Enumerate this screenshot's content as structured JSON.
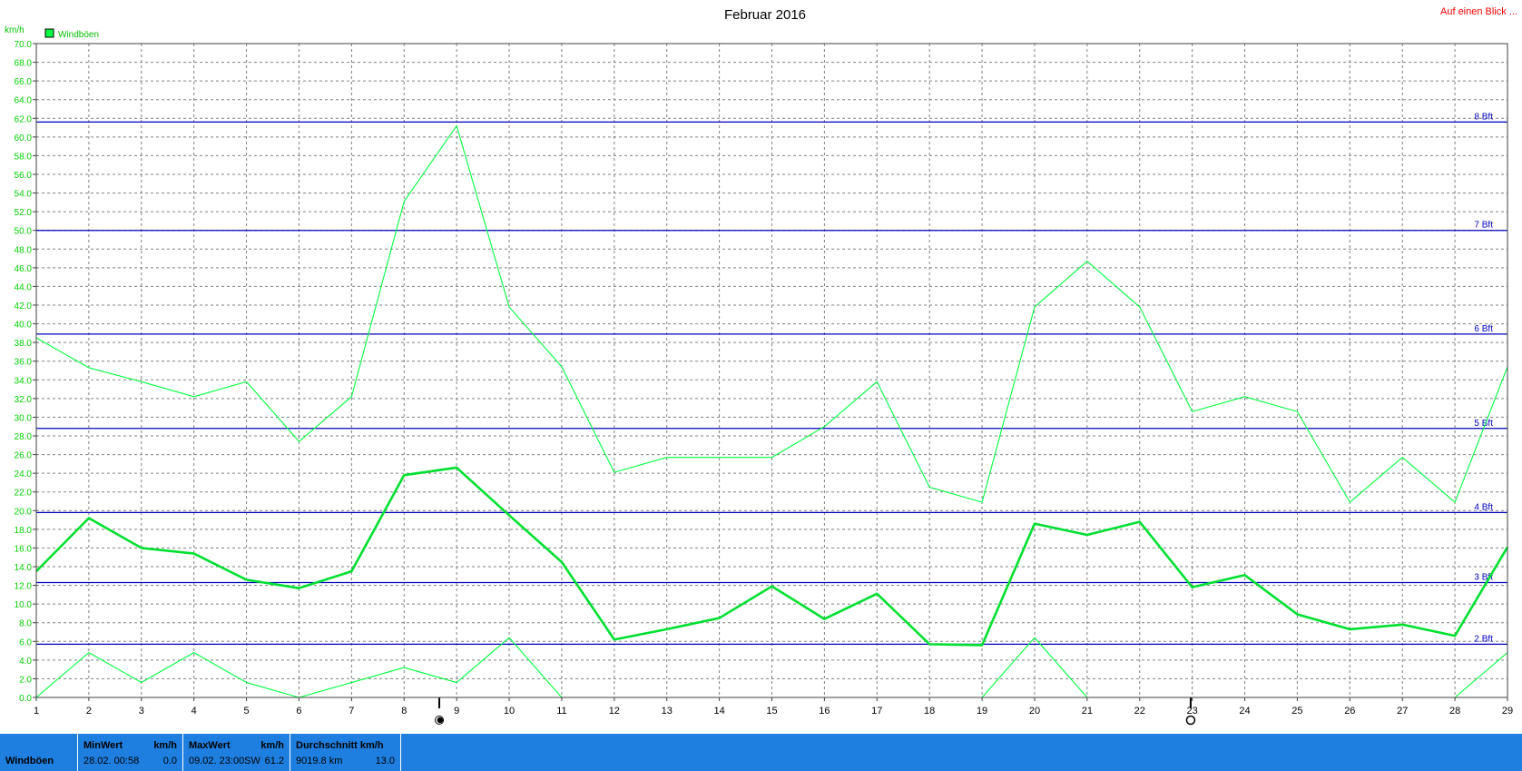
{
  "header": {
    "title": "Februar 2016",
    "link": "Auf einen Blick ...",
    "unit": "km/h",
    "legend": "Windböen"
  },
  "colors": {
    "series": "#00ff40",
    "average": "#00e030",
    "beaufort": "#0000c0",
    "grid": "#808080",
    "stats_bg": "#1e7fe0"
  },
  "chart_data": {
    "type": "line",
    "title": "Februar 2016",
    "ylabel": "km/h",
    "xlabel": "",
    "ylim": [
      0,
      70
    ],
    "ytick_step": 2,
    "x": [
      1,
      2,
      3,
      4,
      5,
      6,
      7,
      8,
      9,
      10,
      11,
      12,
      13,
      14,
      15,
      16,
      17,
      18,
      19,
      20,
      21,
      22,
      23,
      24,
      25,
      26,
      27,
      28,
      29
    ],
    "legend_position": "top-left",
    "grid": true,
    "series": [
      {
        "name": "Windböen",
        "role": "max",
        "values": [
          38.5,
          35.3,
          33.8,
          32.2,
          33.8,
          27.4,
          32.2,
          53.1,
          61.2,
          41.8,
          35.4,
          24.1,
          25.7,
          25.7,
          25.7,
          29.0,
          33.8,
          22.5,
          20.9,
          41.8,
          46.7,
          41.8,
          30.6,
          32.2,
          30.6,
          20.9,
          25.7,
          20.9,
          35.4
        ]
      },
      {
        "role": "average",
        "values": [
          13.5,
          19.2,
          16.0,
          15.4,
          12.6,
          11.7,
          13.5,
          23.8,
          24.6,
          19.5,
          14.5,
          6.2,
          7.3,
          8.5,
          11.9,
          8.4,
          11.1,
          5.7,
          5.6,
          18.6,
          17.4,
          18.8,
          11.8,
          13.1,
          8.9,
          7.3,
          7.8,
          6.6,
          16.1
        ]
      },
      {
        "role": "min",
        "values": [
          0.0,
          4.8,
          1.6,
          4.8,
          1.6,
          0.0,
          1.6,
          3.2,
          1.6,
          6.4,
          0.0,
          null,
          null,
          null,
          null,
          null,
          null,
          null,
          0.0,
          6.4,
          0.0,
          null,
          null,
          null,
          null,
          null,
          null,
          0.0,
          4.8
        ]
      }
    ],
    "reference_lines": [
      {
        "label": "2 Bft",
        "value": 5.7
      },
      {
        "label": "3 Bft",
        "value": 12.3
      },
      {
        "label": "4 Bft",
        "value": 19.8
      },
      {
        "label": "5 Bft",
        "value": 28.8
      },
      {
        "label": "6 Bft",
        "value": 38.9
      },
      {
        "label": "7 Bft",
        "value": 50.0
      },
      {
        "label": "8 Bft",
        "value": 61.6
      }
    ],
    "moon_markers": [
      {
        "x": 8.67,
        "symbol": "new-moon"
      },
      {
        "x": 22.97,
        "symbol": "full-moon"
      }
    ]
  },
  "stats": {
    "row_label": "Windböen",
    "min": {
      "header": "MinWert",
      "unit": "km/h",
      "date": "28.02.",
      "time": "00:58",
      "value": "0.0"
    },
    "max": {
      "header": "MaxWert",
      "unit": "km/h",
      "date": "09.02.",
      "time": "23:00SW",
      "value": "61.2"
    },
    "avg": {
      "header": "Durchschnitt km/h",
      "distance": "9019.8 km",
      "value": "13.0"
    }
  }
}
